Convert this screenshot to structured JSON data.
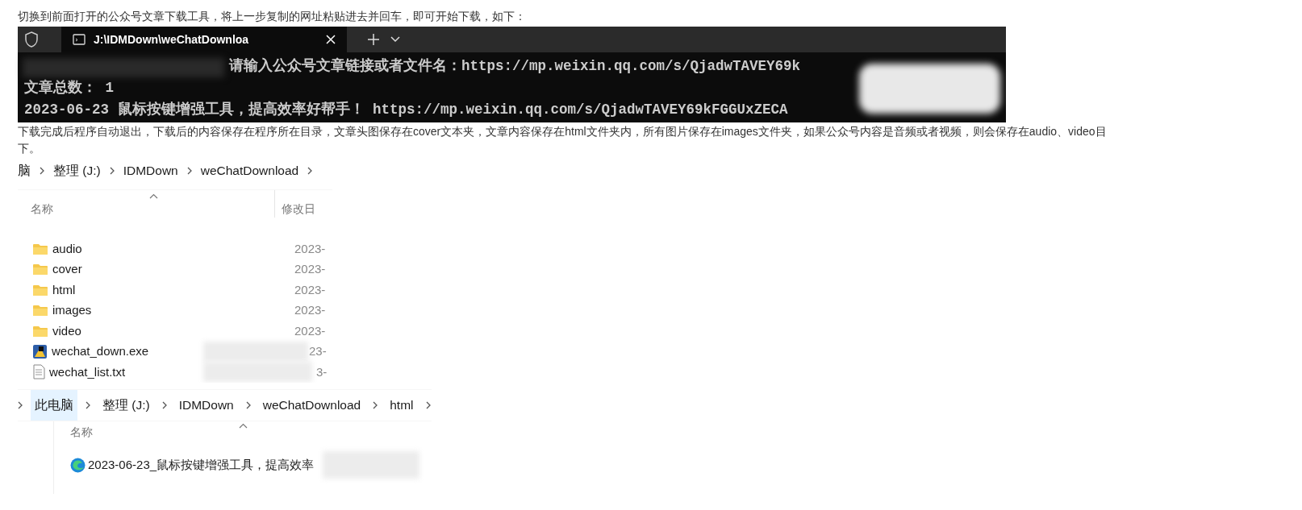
{
  "intro_text": "切换到前面打开的公众号文章下载工具，将上一步复制的网址粘贴进去并回车，即可开始下载，如下：",
  "terminal": {
    "tab_title": "J:\\IDMDown\\weChatDownloa",
    "lines": [
      {
        "kind": "prompt",
        "text": "请输入公众号文章链接或者文件名：https://mp.weixin.qq.com/s/QjadwTAVEY69k"
      },
      {
        "kind": "output",
        "text": "文章总数： 1"
      },
      {
        "kind": "output",
        "text": "2023-06-23 鼠标按键增强工具，提高效率好帮手！ https://mp.weixin.qq.com/s/QjadwTAVEY69kFGGUxZECA"
      }
    ]
  },
  "description_lines": [
    "下载完成后程序自动退出，下载后的内容保存在程序所在目录，文章头图保存在cover文本夹，文章内容保存在html文件夹内，所有图片保存在images文件夹，如果公众号内容是音频或者视频，则会保存在audio、video目",
    "下。"
  ],
  "explorer_1": {
    "breadcrumb": [
      {
        "label": "脑",
        "selected": false
      },
      {
        "label": "整理 (J:)",
        "selected": false
      },
      {
        "label": "IDMDown",
        "selected": false
      },
      {
        "label": "weChatDownload",
        "selected": false
      }
    ],
    "columns": [
      "名称",
      "修改日"
    ],
    "rows": [
      {
        "kind": "folder",
        "name": "audio",
        "modified": "2023-",
        "redacted": false
      },
      {
        "kind": "folder",
        "name": "cover",
        "modified": "2023-",
        "redacted": false
      },
      {
        "kind": "folder",
        "name": "html",
        "modified": "2023-",
        "redacted": false
      },
      {
        "kind": "folder",
        "name": "images",
        "modified": "2023-",
        "redacted": false
      },
      {
        "kind": "folder",
        "name": "video",
        "modified": "2023-",
        "redacted": false
      },
      {
        "kind": "exe",
        "name": "wechat_down.exe",
        "modified": "23-",
        "redacted": true
      },
      {
        "kind": "text",
        "name": "wechat_list.txt",
        "modified": "3-",
        "redacted": true
      }
    ]
  },
  "explorer_2": {
    "breadcrumb": [
      {
        "label": "此电脑",
        "selected": true
      },
      {
        "label": "整理 (J:)",
        "selected": false
      },
      {
        "label": "IDMDown",
        "selected": false
      },
      {
        "label": "weChatDownload",
        "selected": false
      },
      {
        "label": "html",
        "selected": false
      }
    ],
    "columns": [
      "名称"
    ],
    "rows": [
      {
        "kind": "web",
        "name": "2023-06-23_鼠标按键增强工具，提高效率",
        "redacted": true
      }
    ]
  }
}
